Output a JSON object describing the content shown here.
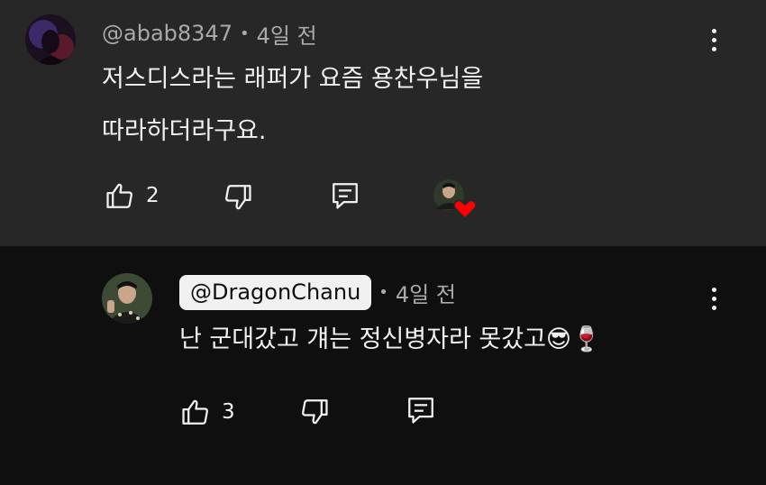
{
  "comment": {
    "author": "@abab8347",
    "time": "4일 전",
    "text_line1": "저스디스라는 래퍼가 요즘 용찬우님을",
    "text_line2": "따라하더라구요.",
    "like_count": "2"
  },
  "reply": {
    "author": "@DragonChanu",
    "time": "4일 전",
    "text": "난 군대갔고 걔는 정신병자라 못갔고😎🍷",
    "like_count": "3"
  },
  "separator": "•",
  "colors": {
    "top_background": "#272727",
    "reply_background": "#0f0f0f",
    "text": "#f1f1f1",
    "meta": "#aaaaaa",
    "creator_chip": "#f1f1f1",
    "heart": "#ff0000"
  },
  "icons": [
    "more-vert-icon",
    "thumb-up-icon",
    "thumb-down-icon",
    "reply-comment-icon",
    "creator-heart-icon"
  ]
}
